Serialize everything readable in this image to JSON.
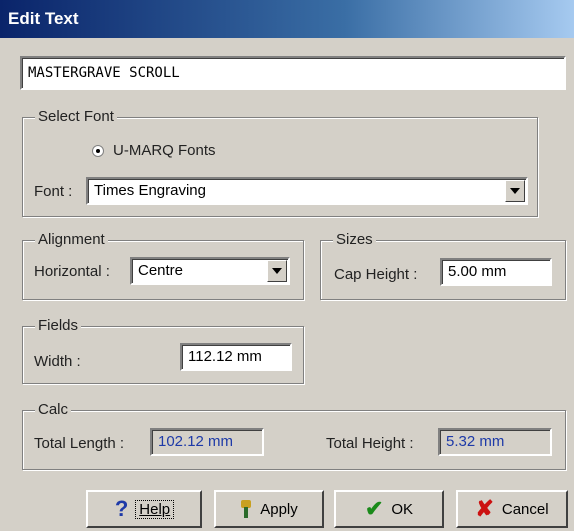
{
  "window": {
    "title": "Edit Text"
  },
  "text_input": {
    "value": "MASTERGRAVE SCROLL"
  },
  "select_font": {
    "group_label": "Select Font",
    "radio_label": "U-MARQ Fonts",
    "font_label": "Font :",
    "font_value": "Times Engraving"
  },
  "alignment": {
    "group_label": "Alignment",
    "horizontal_label": "Horizontal :",
    "horizontal_value": "Centre"
  },
  "sizes": {
    "group_label": "Sizes",
    "cap_height_label": "Cap Height :",
    "cap_height_value": "5.00 mm"
  },
  "fields": {
    "group_label": "Fields",
    "width_label": "Width :",
    "width_value": "112.12 mm"
  },
  "calc": {
    "group_label": "Calc",
    "total_length_label": "Total Length :",
    "total_length_value": "102.12 mm",
    "total_height_label": "Total Height :",
    "total_height_value": "5.32 mm"
  },
  "buttons": {
    "help": "Help",
    "apply": "Apply",
    "ok": "OK",
    "cancel": "Cancel"
  },
  "colors": {
    "accent_value_text": "#1e3aa8"
  }
}
